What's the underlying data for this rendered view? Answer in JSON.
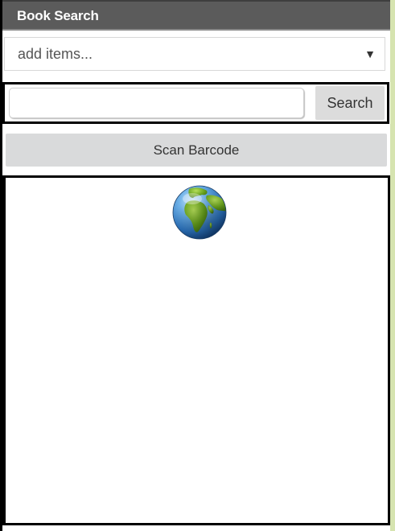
{
  "header": {
    "title": "Book Search"
  },
  "dropdown": {
    "selected": "add items...",
    "arrow": "▼"
  },
  "search": {
    "value": "",
    "placeholder": "",
    "button_label": "Search"
  },
  "scan": {
    "button_label": "Scan Barcode"
  },
  "content": {
    "icon": "globe-icon"
  },
  "colors": {
    "titlebar": "#5b5b5b",
    "button_bg": "#dcdcdc",
    "right_strip": "#d6e4b0",
    "border": "#000000"
  }
}
